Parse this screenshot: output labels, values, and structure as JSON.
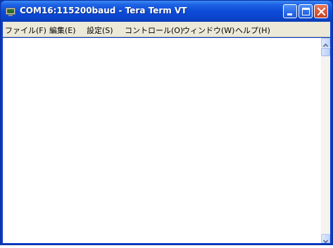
{
  "window": {
    "title": "COM16:115200baud - Tera Term VT",
    "app_icon": "tera-term-icon",
    "controls": [
      "minimize-icon",
      "maximize-icon",
      "close-icon"
    ]
  },
  "menu": {
    "items": [
      "ファイル(F)",
      "編集(E)",
      "設定(S)",
      "コントロール(O)",
      "ウィンドウ(W)",
      "ヘルプ(H)"
    ]
  },
  "terminal": {
    "content": ""
  },
  "scrollbar": {
    "up_icon": "arrow-up-icon",
    "down_icon": "arrow-down-icon"
  },
  "colors": {
    "titlebar": "#0a45cc",
    "menubar": "#ece9d8",
    "close_button": "#d65533",
    "client_background": "#ffffff"
  }
}
